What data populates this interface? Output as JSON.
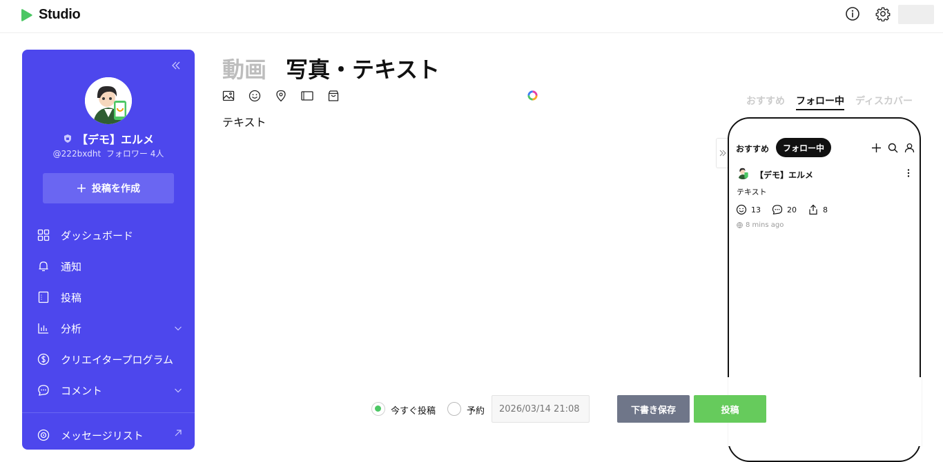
{
  "app": {
    "name": "Studio",
    "brand_color": "#4cc764"
  },
  "header": {
    "icons": [
      "info-icon",
      "gear-icon"
    ]
  },
  "sidebar": {
    "bg_color": "#4d47ed",
    "profile": {
      "name": "【デモ】エルメ",
      "handle": "@222bxdht",
      "followers": "フォロワー 4人"
    },
    "create_button": "投稿を作成",
    "items": [
      {
        "label": "ダッシュボード",
        "icon": "grid-icon"
      },
      {
        "label": "通知",
        "icon": "bell-icon"
      },
      {
        "label": "投稿",
        "icon": "post-icon"
      },
      {
        "label": "分析",
        "icon": "chart-icon",
        "has_chevron": true
      },
      {
        "label": "クリエイタープログラム",
        "icon": "coin-icon"
      },
      {
        "label": "コメント",
        "icon": "comment-icon",
        "has_chevron": true
      },
      {
        "label": "メッセージリスト",
        "icon": "broadcast-icon",
        "external": true
      }
    ]
  },
  "composer": {
    "tabs": [
      "動画",
      "写真・テキスト"
    ],
    "active_tab": "写真・テキスト",
    "text": "テキスト",
    "toolbar": [
      "image-icon",
      "emoji-icon",
      "location-icon",
      "frame-icon",
      "shopping-bag-icon"
    ]
  },
  "preview": {
    "tabs": [
      "おすすめ",
      "フォロー中",
      "ディスカバー"
    ],
    "active_tab": "フォロー中",
    "phone": {
      "tab_recommended": "おすすめ",
      "tab_following": "フォロー中",
      "author": "【デモ】エルメ",
      "text": "テキスト",
      "likes": "13",
      "comments": "20",
      "shares": "8",
      "time": "8 mins ago"
    }
  },
  "schedule": {
    "option_now": "今すぐ投稿",
    "option_schedule": "予約",
    "selected": "今すぐ投稿",
    "datetime_placeholder": "2026/03/14 21:08"
  },
  "actions": {
    "draft": "下書き保存",
    "post": "投稿"
  }
}
